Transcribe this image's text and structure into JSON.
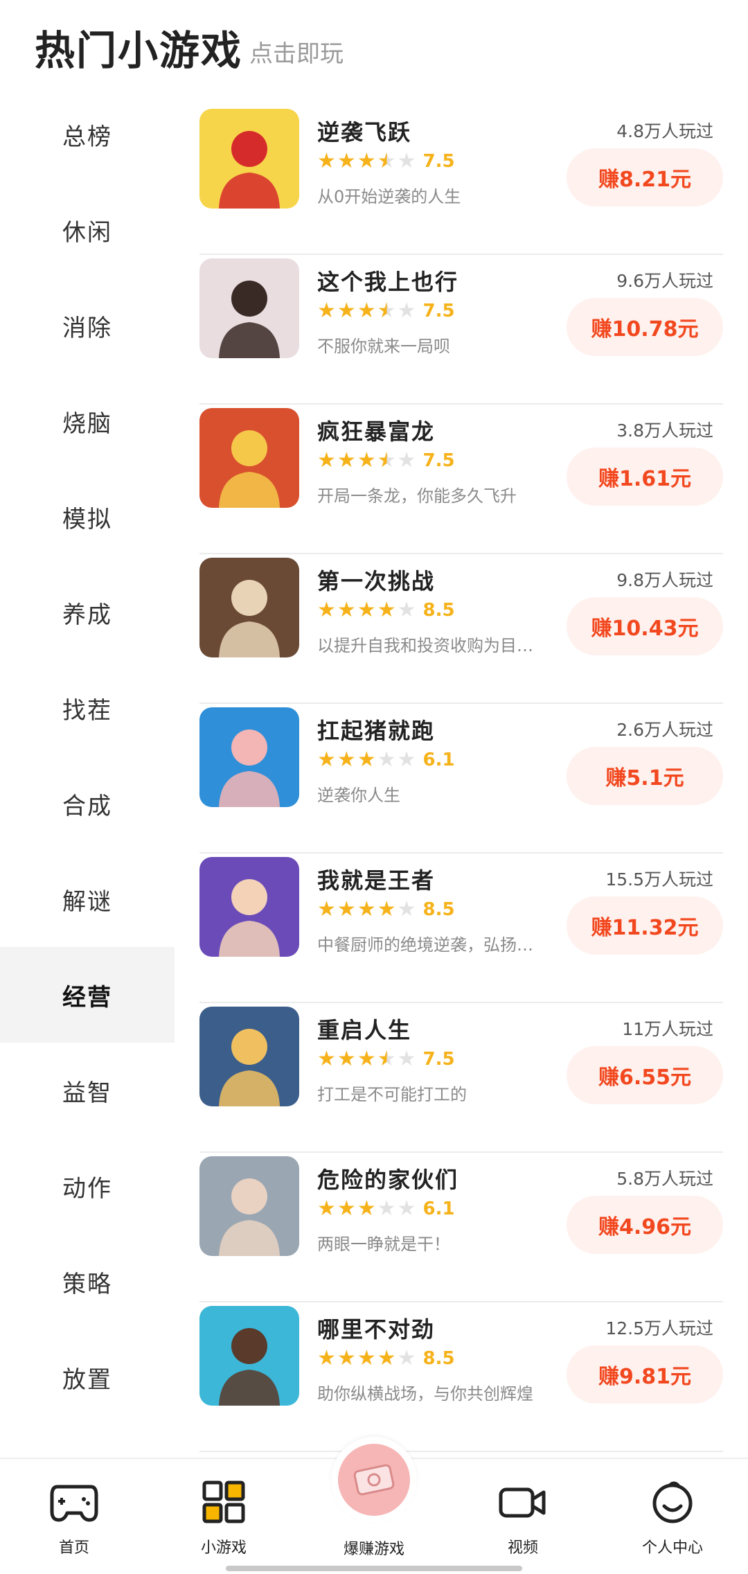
{
  "header": {
    "title": "热门小游戏",
    "subtitle": "点击即玩"
  },
  "sidebar": {
    "items": [
      {
        "label": "总榜",
        "active": false
      },
      {
        "label": "休闲",
        "active": false
      },
      {
        "label": "消除",
        "active": false
      },
      {
        "label": "烧脑",
        "active": false
      },
      {
        "label": "模拟",
        "active": false
      },
      {
        "label": "养成",
        "active": false
      },
      {
        "label": "找茬",
        "active": false
      },
      {
        "label": "合成",
        "active": false
      },
      {
        "label": "解谜",
        "active": false
      },
      {
        "label": "经营",
        "active": true
      },
      {
        "label": "益智",
        "active": false
      },
      {
        "label": "动作",
        "active": false
      },
      {
        "label": "策略",
        "active": false
      },
      {
        "label": "放置",
        "active": false
      }
    ]
  },
  "games": [
    {
      "name": "逆袭飞跃",
      "rating": 3.5,
      "score": "7.5",
      "desc": "从0开始逆袭的人生",
      "played": "4.8万人玩过",
      "earn": "赚8.21元",
      "colors": [
        "#f7d54a",
        "#d62b2b"
      ]
    },
    {
      "name": "这个我上也行",
      "rating": 3.5,
      "score": "7.5",
      "desc": "不服你就来一局呗",
      "played": "9.6万人玩过",
      "earn": "赚10.78元",
      "colors": [
        "#e9dde0",
        "#3a2a26"
      ]
    },
    {
      "name": "疯狂暴富龙",
      "rating": 3.5,
      "score": "7.5",
      "desc": "开局一条龙，你能多久飞升",
      "played": "3.8万人玩过",
      "earn": "赚1.61元",
      "colors": [
        "#d9502e",
        "#f5c84a"
      ]
    },
    {
      "name": "第一次挑战",
      "rating": 4,
      "score": "8.5",
      "desc": "以提升自我和投资收购为目…",
      "played": "9.8万人玩过",
      "earn": "赚10.43元",
      "colors": [
        "#6b4a35",
        "#e8d3b6"
      ]
    },
    {
      "name": "扛起猪就跑",
      "rating": 3,
      "score": "6.1",
      "desc": "逆袭你人生",
      "played": "2.6万人玩过",
      "earn": "赚5.1元",
      "colors": [
        "#2f8fd8",
        "#f4b5b5"
      ]
    },
    {
      "name": "我就是王者",
      "rating": 4,
      "score": "8.5",
      "desc": "中餐厨师的绝境逆袭，弘扬…",
      "played": "15.5万人玩过",
      "earn": "赚11.32元",
      "colors": [
        "#6a4bb8",
        "#f3d2b8"
      ]
    },
    {
      "name": "重启人生",
      "rating": 3.5,
      "score": "7.5",
      "desc": "打工是不可能打工的",
      "played": "11万人玩过",
      "earn": "赚6.55元",
      "colors": [
        "#3b5e8a",
        "#f0c060"
      ]
    },
    {
      "name": "危险的家伙们",
      "rating": 3,
      "score": "6.1",
      "desc": "两眼一睁就是干！",
      "played": "5.8万人玩过",
      "earn": "赚4.96元",
      "colors": [
        "#9aa6b2",
        "#e9d2c2"
      ]
    },
    {
      "name": "哪里不对劲",
      "rating": 4,
      "score": "8.5",
      "desc": "助你纵横战场，与你共创辉煌",
      "played": "12.5万人玩过",
      "earn": "赚9.81元",
      "colors": [
        "#3cb7d8",
        "#5a3a2a"
      ]
    }
  ],
  "bottom_nav": [
    {
      "label": "首页",
      "icon": "gamepad-icon"
    },
    {
      "label": "小游戏",
      "icon": "grid-icon"
    },
    {
      "label": "爆赚游戏",
      "icon": "money-icon"
    },
    {
      "label": "视频",
      "icon": "video-icon"
    },
    {
      "label": "个人中心",
      "icon": "smile-icon"
    }
  ],
  "colors": {
    "accent": "#f2481f",
    "star": "#f6b21a",
    "earn_bg": "#fff1ee"
  }
}
